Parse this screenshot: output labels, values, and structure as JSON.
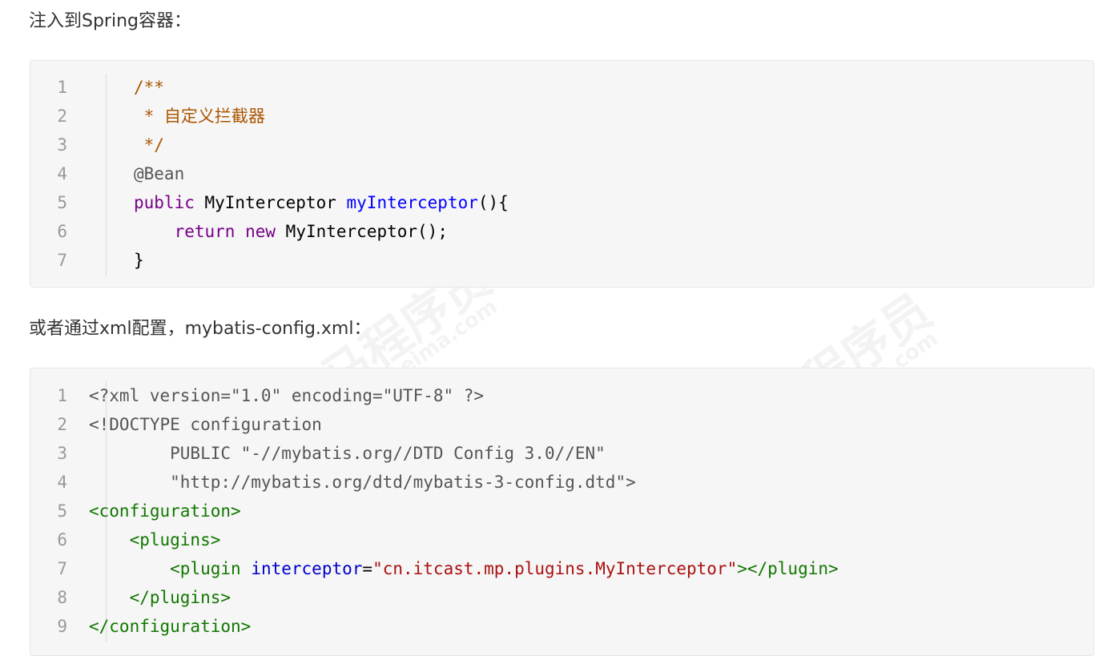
{
  "paragraphs": {
    "p1": "注入到Spring容器：",
    "p2": "或者通过xml配置，mybatis-config.xml："
  },
  "code_block_1": {
    "lines": [
      {
        "n": "1",
        "tokens": [
          {
            "t": "/**",
            "c": "comment"
          }
        ]
      },
      {
        "n": "2",
        "tokens": [
          {
            "t": " * 自定义拦截器",
            "c": "comment"
          }
        ]
      },
      {
        "n": "3",
        "tokens": [
          {
            "t": " */",
            "c": "comment"
          }
        ]
      },
      {
        "n": "4",
        "tokens": [
          {
            "t": "@Bean",
            "c": "meta"
          }
        ]
      },
      {
        "n": "5",
        "tokens": [
          {
            "t": "public",
            "c": "keyword"
          },
          {
            "t": " MyInterceptor ",
            "c": "plain"
          },
          {
            "t": "myInterceptor",
            "c": "def"
          },
          {
            "t": "(){",
            "c": "plain"
          }
        ]
      },
      {
        "n": "6",
        "tokens": [
          {
            "t": "    ",
            "c": "plain"
          },
          {
            "t": "return",
            "c": "keyword"
          },
          {
            "t": " ",
            "c": "plain"
          },
          {
            "t": "new",
            "c": "keyword"
          },
          {
            "t": " MyInterceptor();",
            "c": "plain"
          }
        ]
      },
      {
        "n": "7",
        "tokens": [
          {
            "t": "}",
            "c": "plain"
          }
        ]
      }
    ]
  },
  "code_block_2": {
    "lines": [
      {
        "n": "1",
        "tokens": [
          {
            "t": "<?xml version=\"1.0\" encoding=\"UTF-8\" ?>",
            "c": "decl"
          }
        ]
      },
      {
        "n": "2",
        "tokens": [
          {
            "t": "<!DOCTYPE configuration",
            "c": "decl"
          }
        ]
      },
      {
        "n": "3",
        "tokens": [
          {
            "t": "        PUBLIC \"-//mybatis.org//DTD Config 3.0//EN\"",
            "c": "decl"
          }
        ]
      },
      {
        "n": "4",
        "tokens": [
          {
            "t": "        \"http://mybatis.org/dtd/mybatis-3-config.dtd\">",
            "c": "decl"
          }
        ]
      },
      {
        "n": "5",
        "tokens": [
          {
            "t": "<configuration>",
            "c": "tag"
          }
        ]
      },
      {
        "n": "6",
        "tokens": [
          {
            "t": "    ",
            "c": "plain"
          },
          {
            "t": "<plugins>",
            "c": "tag"
          }
        ]
      },
      {
        "n": "7",
        "tokens": [
          {
            "t": "        ",
            "c": "plain"
          },
          {
            "t": "<plugin",
            "c": "tag"
          },
          {
            "t": " ",
            "c": "plain"
          },
          {
            "t": "interceptor",
            "c": "attr"
          },
          {
            "t": "=",
            "c": "plain"
          },
          {
            "t": "\"cn.itcast.mp.plugins.MyInterceptor\"",
            "c": "string"
          },
          {
            "t": "></plugin>",
            "c": "tag"
          }
        ]
      },
      {
        "n": "8",
        "tokens": [
          {
            "t": "    ",
            "c": "plain"
          },
          {
            "t": "</plugins>",
            "c": "tag"
          }
        ]
      },
      {
        "n": "9",
        "tokens": [
          {
            "t": "</configuration>",
            "c": "tag"
          }
        ]
      }
    ]
  },
  "watermark": {
    "brand": "黑马程序员",
    "url": "www.itheima.com"
  },
  "colors": {
    "comment": "#aa5500",
    "keyword": "#770088",
    "def": "#0000ff",
    "tag": "#117700",
    "attr": "#0000cc",
    "string": "#aa1111"
  }
}
